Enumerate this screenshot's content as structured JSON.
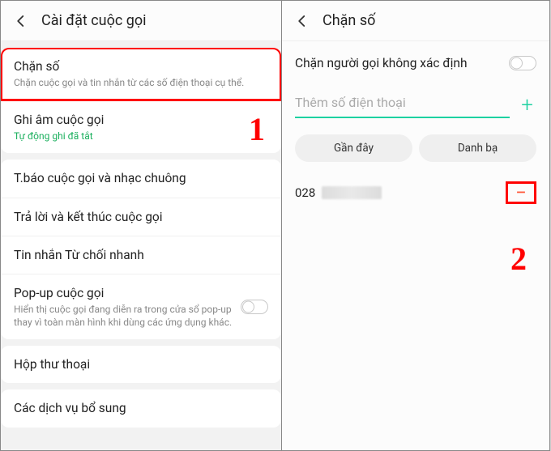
{
  "left": {
    "headerTitle": "Cài đặt cuộc gọi",
    "items": {
      "blockTitle": "Chặn số",
      "blockSub": "Chặn cuộc gọi và tin nhắn từ các số điện thoại cụ thể.",
      "recordTitle": "Ghi âm cuộc gọi",
      "recordSub": "Tự động ghi đã tắt",
      "alertsTitle": "T.báo cuộc gọi và nhạc chuông",
      "answerTitle": "Trả lời và kết thúc cuộc gọi",
      "quickDeclineTitle": "Tin nhắn Từ chối nhanh",
      "popupTitle": "Pop-up cuộc gọi",
      "popupSub": "Hiển thị cuộc gọi đang diễn ra trong cửa sổ pop-up thay vì toàn màn hình khi dùng các ứng dụng khác.",
      "vmailTitle": "Hộp thư thoại",
      "suppTitle": "Các dịch vụ bổ sung"
    },
    "annotation1": "1"
  },
  "right": {
    "headerTitle": "Chặn số",
    "unknownLabel": "Chặn người gọi không xác định",
    "addPlaceholder": "Thêm số điện thoại",
    "recentBtn": "Gần đây",
    "contactsBtn": "Danh bạ",
    "blockedNumber": "028",
    "annotation2": "2"
  }
}
